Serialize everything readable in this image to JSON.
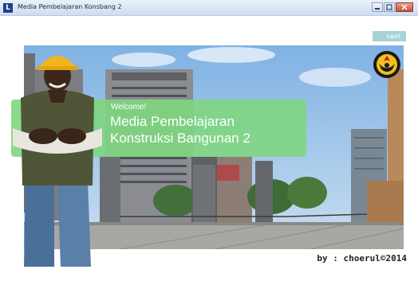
{
  "window": {
    "title": "Media Pembelajaran Konsbang 2",
    "app_icon_letter": "L",
    "buttons": [
      "minimize-icon",
      "maximize-icon",
      "close-icon"
    ]
  },
  "nav": {
    "next_label": "next"
  },
  "banner": {
    "welcome": "Welcome!",
    "title_line1": "Media Pembelajaran",
    "title_line2": "Konstruksi Bangunan 2",
    "color": "#7ed680"
  },
  "footer": {
    "credit": "by : choerul©2014"
  },
  "scene": {
    "description_icon": "city-plaza-photo"
  },
  "logo": {
    "icon": "university-emblem-icon"
  },
  "worker": {
    "icon": "construction-worker-photo"
  }
}
